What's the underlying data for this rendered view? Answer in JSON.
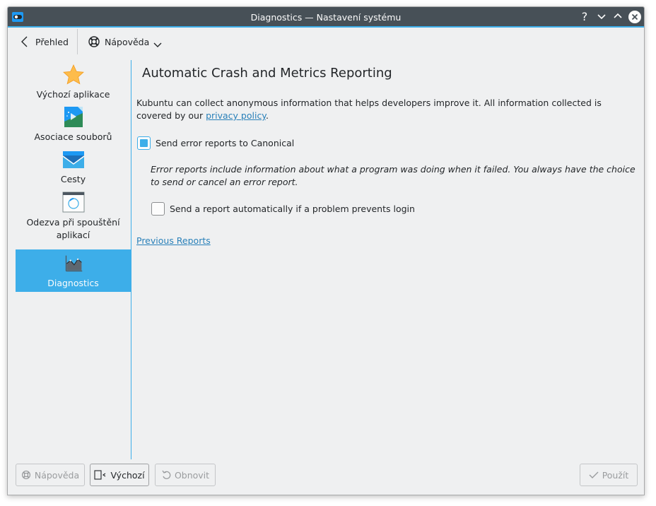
{
  "window": {
    "title": "Diagnostics  — Nastavení systému",
    "help_glyph": "?",
    "minimize_glyph": "⌄",
    "maximize_glyph": "⌃",
    "close_glyph": "✕"
  },
  "toolbar": {
    "back_label": "Přehled",
    "help_label": "Nápověda"
  },
  "sidebar": {
    "items": [
      {
        "label": "Výchozí aplikace",
        "icon": "star-icon"
      },
      {
        "label": "Asociace souborů",
        "icon": "file-associations-icon"
      },
      {
        "label": "Cesty",
        "icon": "folder-mail-icon"
      },
      {
        "label": "Odezva při spouštění aplikací",
        "icon": "launch-feedback-icon"
      },
      {
        "label": "Diagnostics",
        "icon": "diagnostics-chart-icon",
        "selected": true
      }
    ]
  },
  "main": {
    "heading": "Automatic Crash and Metrics Reporting",
    "intro_text": "Kubuntu can collect anonymous information that helps developers improve it. All information collected is covered by our ",
    "privacy_link": "privacy policy",
    "intro_end": ".",
    "send_reports_label": "Send error reports to Canonical",
    "send_reports_checked": true,
    "note_text": "Error reports include information about what a program was doing when it failed. You always have the choice to send or cancel an error report.",
    "auto_report_label": "Send a report automatically if a problem prevents login",
    "auto_report_checked": false,
    "previous_reports_link": "Previous Reports"
  },
  "buttons": {
    "help": "Nápověda",
    "defaults": "Výchozí",
    "reset": "Obnovit",
    "apply": "Použít"
  },
  "colors": {
    "accent": "#3daee9",
    "titlebar": "#475057",
    "window_bg": "#eff0f1",
    "link": "#2980b9"
  }
}
